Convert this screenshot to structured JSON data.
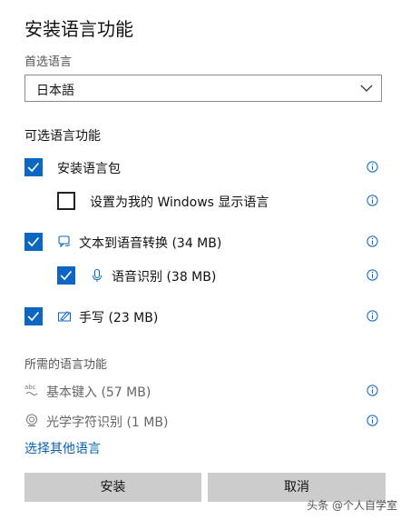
{
  "dialog": {
    "title": "安装语言功能",
    "preferred_language_label": "首选语言",
    "preferred_language_value": "日本語",
    "optional_features_title": "可选语言功能",
    "required_features_title": "所需的语言功能",
    "other_language_link": "选择其他语言",
    "install_label": "安装",
    "cancel_label": "取消"
  },
  "optional_features": [
    {
      "label": "安装语言包",
      "checked": true,
      "icon": "none"
    },
    {
      "label": "设置为我的 Windows 显示语言",
      "checked": false,
      "icon": "none"
    },
    {
      "label": "文本到语音转换 (34 MB)",
      "checked": true,
      "icon": "text-to-speech-icon"
    },
    {
      "label": "语音识别 (38 MB)",
      "checked": true,
      "icon": "microphone-icon"
    },
    {
      "label": "手写 (23 MB)",
      "checked": true,
      "icon": "handwriting-pen-icon"
    }
  ],
  "required_features": [
    {
      "label": "基本键入 (57 MB)",
      "icon": "abc-spellcheck-icon"
    },
    {
      "label": "光学字符识别 (1 MB)",
      "icon": "ocr-camera-icon"
    }
  ],
  "watermark": "头条 @个人自学室",
  "colors": {
    "accent": "#0b67c2",
    "link": "#0b5fb0",
    "button": "#cccccc"
  }
}
